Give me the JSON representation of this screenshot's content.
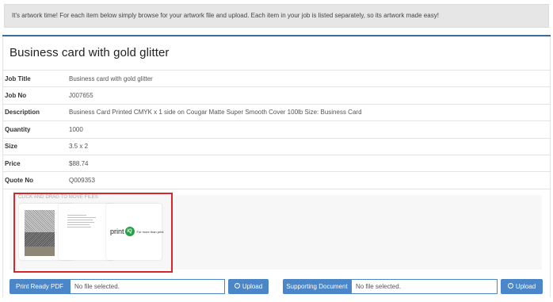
{
  "notice": "It's artwork time! For each item below simply browse for your artwork file and upload. Each item in your job is listed separately, so its artwork made easy!",
  "panel_title": "Business card with gold glitter",
  "details": [
    {
      "label": "Job Title",
      "value": "Business card with gold glitter"
    },
    {
      "label": "Job No",
      "value": "J007655"
    },
    {
      "label": "Description",
      "value": "Business Card Printed CMYK x 1 side on Cougar Matte Super Smooth Cover 100lb Size: Business Card"
    },
    {
      "label": "Quantity",
      "value": "1000"
    },
    {
      "label": "Size",
      "value": "3.5 x 2"
    },
    {
      "label": "Price",
      "value": "$88.74"
    },
    {
      "label": "Quote No",
      "value": "Q009353"
    }
  ],
  "files": {
    "drag_hint": "CLICK AND DRAG TO MOVE FILES",
    "thumbs": [
      {
        "icon": "glitter-artwork-thumbnail"
      },
      {
        "icon": "text-document-thumbnail"
      },
      {
        "icon": "printiq-logo-thumbnail",
        "logo_text": "print",
        "logo_badge": "iQ",
        "logo_tag": "For more than print"
      }
    ]
  },
  "uploads": {
    "left": {
      "label": "Print Ready PDF",
      "input_value": "No file selected.",
      "button": "Upload"
    },
    "right": {
      "label": "Supporting Document",
      "input_value": "No file selected.",
      "button": "Upload"
    }
  },
  "colors": {
    "accent": "#4a86c8",
    "highlight": "#d8262c",
    "divider": "#3a6e9b"
  }
}
